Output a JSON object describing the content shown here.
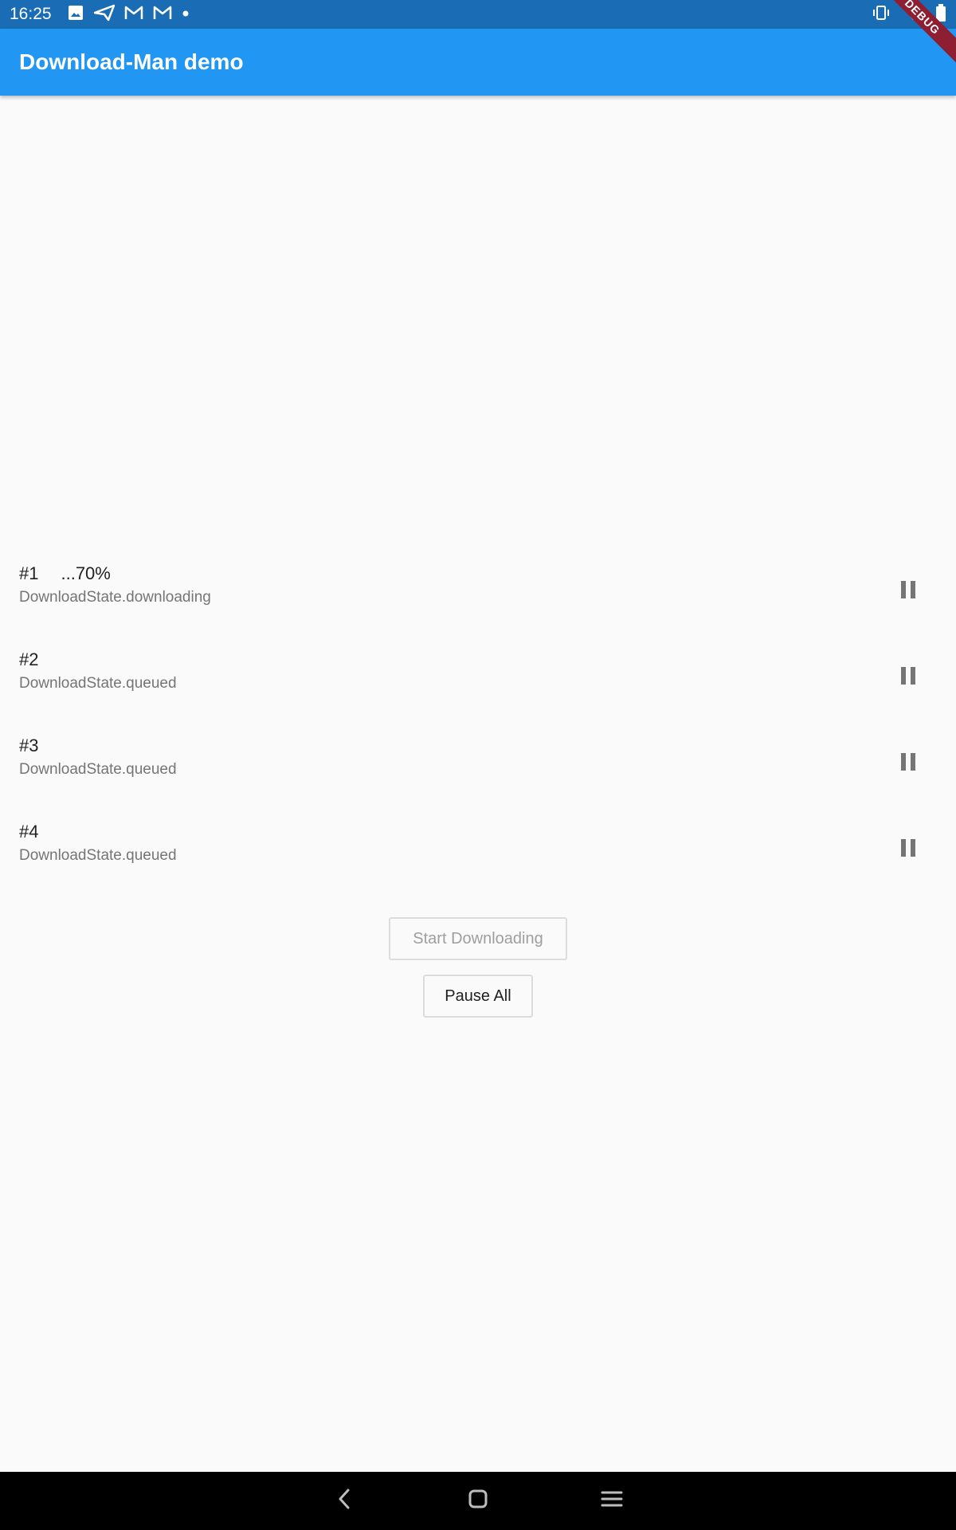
{
  "status_bar": {
    "time": "16:25",
    "left_icons": [
      "image-icon",
      "send-icon",
      "gmail-icon",
      "gmail-icon",
      "dot-icon"
    ],
    "right_icons": [
      "vibrate-icon",
      "wifi-icon",
      "battery-icon"
    ]
  },
  "app_bar": {
    "title": "Download-Man demo",
    "color": "#2196f3",
    "debug_banner": "DEBUG"
  },
  "downloads": [
    {
      "title": "#1",
      "progress": "...70%",
      "state": "DownloadState.downloading",
      "action_icon": "pause-icon"
    },
    {
      "title": "#2",
      "progress": "",
      "state": "DownloadState.queued",
      "action_icon": "pause-icon"
    },
    {
      "title": "#3",
      "progress": "",
      "state": "DownloadState.queued",
      "action_icon": "pause-icon"
    },
    {
      "title": "#4",
      "progress": "",
      "state": "DownloadState.queued",
      "action_icon": "pause-icon"
    }
  ],
  "buttons": {
    "start_label": "Start Downloading",
    "start_enabled": false,
    "pause_all_label": "Pause All"
  },
  "nav_bar": {
    "items": [
      "back-icon",
      "home-icon",
      "menu-icon"
    ]
  }
}
